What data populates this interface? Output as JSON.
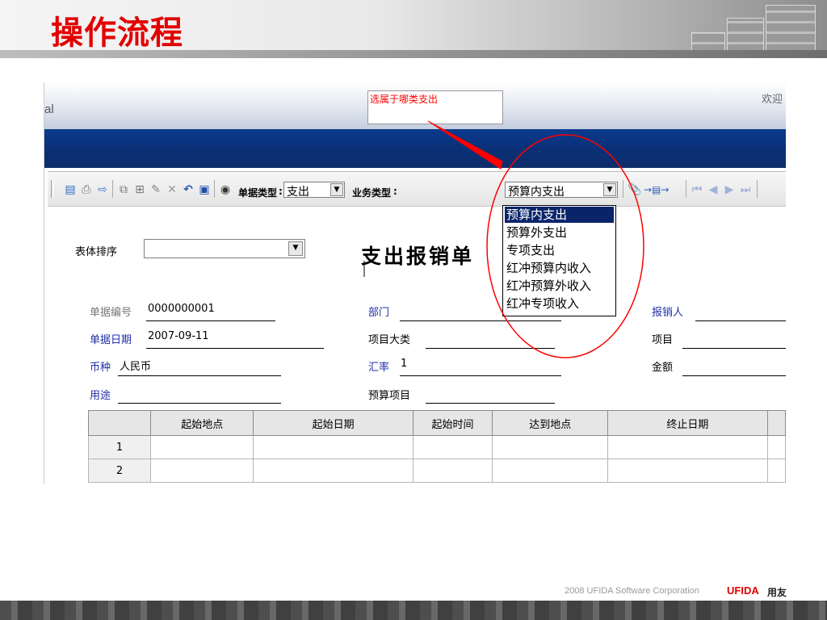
{
  "slide": {
    "title": "操作流程",
    "footer": {
      "copyright": "2008 UFIDA Software Corporation",
      "brand": "UFIDA",
      "brand_cn": "用友"
    }
  },
  "app": {
    "logo_fragment": "al",
    "welcome": "欢迎",
    "annotation": {
      "callout_text": "选属于哪类支出"
    },
    "toolbar": {
      "doc_type_label": "单据类型",
      "doc_type_value": "支出",
      "biz_type_label": "业务类型",
      "biz_type_value": "预算内支出",
      "icons": [
        "preview-icon",
        "print-icon",
        "export-icon",
        "copy-icon",
        "add-icon",
        "edit-icon",
        "delete-icon",
        "undo-icon",
        "save-icon",
        "find-icon",
        "attachment-icon",
        "flow-icon",
        "first-icon",
        "prev-icon",
        "next-icon",
        "last-icon"
      ]
    },
    "dropdown": {
      "options": [
        "预算内支出",
        "预算外支出",
        "专项支出",
        "红冲预算内收入",
        "红冲预算外收入",
        "红冲专项收入"
      ],
      "selected_index": 0
    },
    "form": {
      "sort_label": "表体排序",
      "title": "支出报销单",
      "fields": {
        "doc_no_label": "单据编号",
        "doc_no_value": "0000000001",
        "doc_date_label": "单据日期",
        "doc_date_value": "2007-09-11",
        "currency_label": "币种",
        "currency_value": "人民币",
        "purpose_label": "用途",
        "dept_label": "部门",
        "project_category_label": "项目大类",
        "rate_label": "汇率",
        "rate_value": "1",
        "budget_item_label": "预算项目",
        "claimant_label": "报销人",
        "project_label": "项目",
        "amount_label": "金额"
      }
    },
    "grid": {
      "columns": [
        "起始地点",
        "起始日期",
        "起始时间",
        "达到地点",
        "终止日期"
      ],
      "rows": [
        "1",
        "2"
      ]
    }
  }
}
